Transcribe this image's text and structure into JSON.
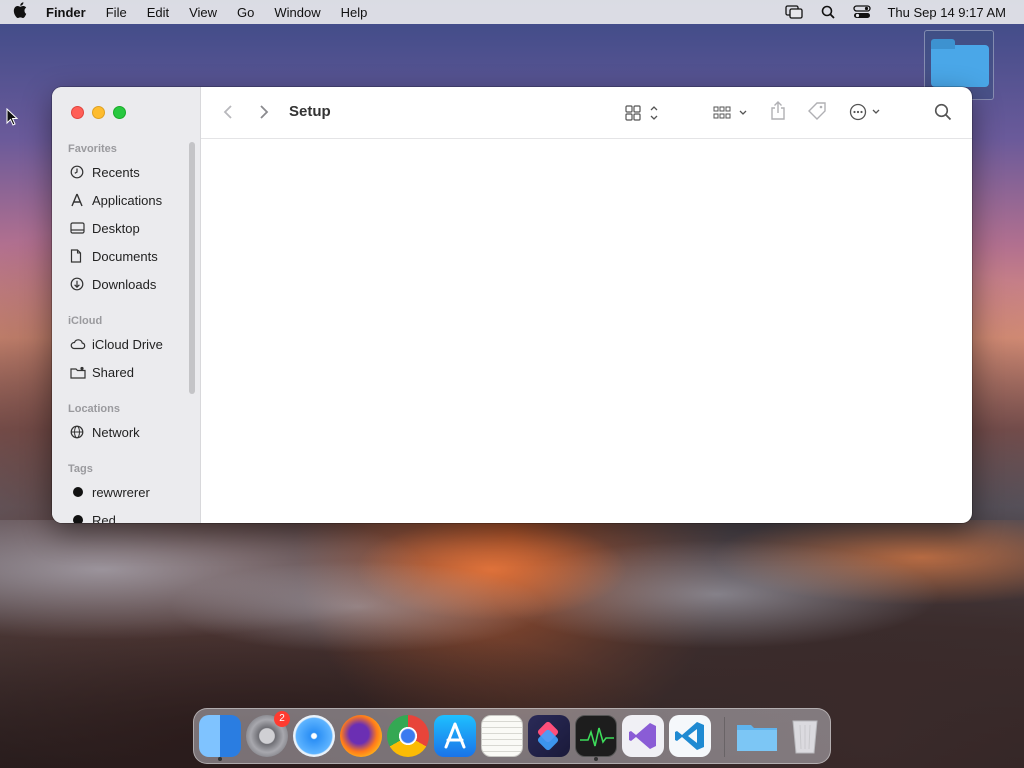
{
  "menubar": {
    "app_name": "Finder",
    "items": [
      "File",
      "Edit",
      "View",
      "Go",
      "Window",
      "Help"
    ],
    "clock": "Thu Sep 14  9:17 AM"
  },
  "window": {
    "title": "Setup",
    "sidebar": {
      "favorites_header": "Favorites",
      "favorites": [
        {
          "label": "Recents",
          "icon": "clock-icon"
        },
        {
          "label": "Applications",
          "icon": "applications-icon"
        },
        {
          "label": "Desktop",
          "icon": "desktop-icon"
        },
        {
          "label": "Documents",
          "icon": "document-icon"
        },
        {
          "label": "Downloads",
          "icon": "download-icon"
        }
      ],
      "icloud_header": "iCloud",
      "icloud": [
        {
          "label": "iCloud Drive",
          "icon": "cloud-icon"
        },
        {
          "label": "Shared",
          "icon": "shared-folder-icon"
        }
      ],
      "locations_header": "Locations",
      "locations": [
        {
          "label": "Network",
          "icon": "globe-icon"
        }
      ],
      "tags_header": "Tags",
      "tags": [
        {
          "label": "rewwrerer",
          "color": "#111111"
        },
        {
          "label": "Red",
          "color": "#111111"
        }
      ]
    }
  },
  "dock": {
    "apps": [
      {
        "name": "Finder",
        "color": "#3d8ff0"
      },
      {
        "name": "System Settings",
        "color": "#8e8e93",
        "badge": "2"
      },
      {
        "name": "Safari",
        "color": "#2b8ff5"
      },
      {
        "name": "Firefox",
        "color": "#6b2fb3"
      },
      {
        "name": "Chrome",
        "color": "#e8e8e8"
      },
      {
        "name": "App Store",
        "color": "#1c8cf2"
      },
      {
        "name": "TextEdit",
        "color": "#f4f4f0"
      },
      {
        "name": "Shortcuts",
        "color": "#2a2a4a"
      },
      {
        "name": "Activity Monitor",
        "color": "#1d1d1d"
      },
      {
        "name": "Visual Studio",
        "color": "#f0f0f5"
      },
      {
        "name": "VS Code",
        "color": "#f5f8fb"
      },
      {
        "name": "Folder",
        "color": "#5fb4ee"
      },
      {
        "name": "Trash",
        "color": "#d8d8dc"
      }
    ]
  }
}
